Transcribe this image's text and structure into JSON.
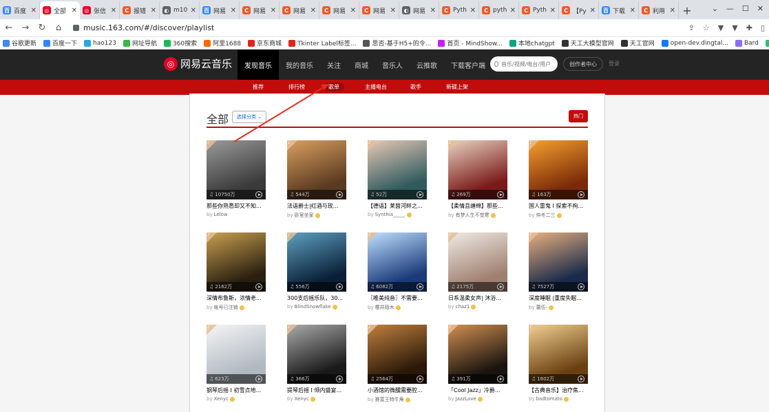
{
  "browser": {
    "tabs": [
      {
        "title": "百度",
        "color": "#3385ff",
        "glyph": "百"
      },
      {
        "title": "全部",
        "color": "#e60026",
        "glyph": "◎",
        "active": true
      },
      {
        "title": "张信",
        "color": "#e60026",
        "glyph": "◎"
      },
      {
        "title": "报错",
        "color": "#f05a28",
        "glyph": "C"
      },
      {
        "title": "m10",
        "color": "#5f6368",
        "glyph": "◐"
      },
      {
        "title": "网易",
        "color": "#3385ff",
        "glyph": "百"
      },
      {
        "title": "网易",
        "color": "#f05a28",
        "glyph": "C"
      },
      {
        "title": "网易",
        "color": "#f05a28",
        "glyph": "C"
      },
      {
        "title": "网易",
        "color": "#f05a28",
        "glyph": "C"
      },
      {
        "title": "网易",
        "color": "#f05a28",
        "glyph": "C"
      },
      {
        "title": "网易",
        "color": "#5f6368",
        "glyph": "◐"
      },
      {
        "title": "Pyth",
        "color": "#f05a28",
        "glyph": "C"
      },
      {
        "title": "pyth",
        "color": "#f05a28",
        "glyph": "C"
      },
      {
        "title": "Pyth",
        "color": "#f05a28",
        "glyph": "C"
      },
      {
        "title": "【Py",
        "color": "#f05a28",
        "glyph": "C"
      },
      {
        "title": "下载",
        "color": "#3385ff",
        "glyph": "百"
      },
      {
        "title": "利用",
        "color": "#f05a28",
        "glyph": "C"
      }
    ],
    "url": "music.163.com/#/discover/playlist",
    "bookmarks": [
      {
        "label": "谷歌更新",
        "color": "#4285f4"
      },
      {
        "label": "百度一下",
        "color": "#3385ff"
      },
      {
        "label": "hao123",
        "color": "#2ea7e0"
      },
      {
        "label": "网址导航",
        "color": "#3bb54a"
      },
      {
        "label": "360搜索",
        "color": "#19b955"
      },
      {
        "label": "阿里1688",
        "color": "#ff6a00"
      },
      {
        "label": "京东商城",
        "color": "#e1251b"
      },
      {
        "label": "Tkinter Label标签...",
        "color": "#e1251b"
      },
      {
        "label": "思否-基于H5+的令...",
        "color": "#555555"
      },
      {
        "label": "首页 - MindShow...",
        "color": "#c41dff"
      },
      {
        "label": "本地chatgpt",
        "color": "#10a37f"
      },
      {
        "label": "天工大模型官网",
        "color": "#333333"
      },
      {
        "label": "天工官网",
        "color": "#333333"
      },
      {
        "label": "open-dev.dingtal...",
        "color": "#1677ff"
      },
      {
        "label": "Bard",
        "color": "#8e6cff"
      },
      {
        "label": "Dashboard - Run...",
        "color": "#2fbf71"
      }
    ]
  },
  "site": {
    "logo_text": "网易云音乐",
    "nav": [
      "发现音乐",
      "我的音乐",
      "关注",
      "商城",
      "音乐人",
      "云推歌",
      "下载客户端"
    ],
    "search_placeholder": "音乐/视频/电台/用户",
    "creator_label": "创作者中心",
    "login_label": "登录",
    "subnav": [
      "推荐",
      "排行榜",
      "歌单",
      "主播电台",
      "歌手",
      "新碟上架"
    ]
  },
  "playlist_page": {
    "title": "全部",
    "category_button": "选择分类 ⌄",
    "hot_button": "热门",
    "cards": [
      {
        "name": "那些你熟悉却又不知...",
        "by": "Lelow",
        "plays": "10750万",
        "c1": "#3a3a3a",
        "c2": "#9a9a9a",
        "vip": false
      },
      {
        "name": "法语爵士|红酒与玫...",
        "by": "卧室坐家",
        "plays": "544万",
        "c1": "#5a3a20",
        "c2": "#d9a060",
        "vip": true
      },
      {
        "name": "【德语】莱茵河畔之...",
        "by": "Synthia_____",
        "plays": "52万",
        "c1": "#2f5a5e",
        "c2": "#e7c9b5",
        "vip": true
      },
      {
        "name": "【柔情且缠绵】那些...",
        "by": "有梦人生不觉寒",
        "plays": "269万",
        "c1": "#7a1a1a",
        "c2": "#e8d3c0",
        "vip": true
      },
      {
        "name": "国人雷鬼 I 探索不拘...",
        "by": "仲冬二三",
        "plays": "163万",
        "c1": "#7a2a08",
        "c2": "#f5a030",
        "vip": true
      },
      {
        "name": "深情布鲁斯，浓情老...",
        "by": "帐号已注销",
        "plays": "2162万",
        "c1": "#2a2010",
        "c2": "#c8a050",
        "vip": true
      },
      {
        "name": "300支后摇乐队，30...",
        "by": "BlindSnowflake",
        "plays": "556万",
        "c1": "#0a2038",
        "c2": "#5fa0c0",
        "vip": true
      },
      {
        "name": "〖唯美纯音〗不需要...",
        "by": "樱井陌木",
        "plays": "6082万",
        "c1": "#1a3a7a",
        "c2": "#bfe0ff",
        "vip": true
      },
      {
        "name": "日系温柔女声| 沐浴...",
        "by": "chaz1",
        "plays": "2175万",
        "c1": "#a08070",
        "c2": "#f0ebe6",
        "vip": true
      },
      {
        "name": "深度睡眠 |重度失眠...",
        "by": "蕾伍-",
        "plays": "7527万",
        "c1": "#1a2a4a",
        "c2": "#e8b080",
        "vip": true
      },
      {
        "name": "钢琴后摇 I 初雪点地...",
        "by": "Xenyc",
        "plays": "623万",
        "c1": "#b0b8c0",
        "c2": "#f5f5f5",
        "vip": true
      },
      {
        "name": "提琴后摇 I 倾内盛宴...",
        "by": "Xenyc",
        "plays": "366万",
        "c1": "#1a1a1a",
        "c2": "#aaaaaa",
        "vip": true
      },
      {
        "name": "小酒馆的微醺需要腔...",
        "by": "赛富王特牛角",
        "plays": "2564万",
        "c1": "#2a1808",
        "c2": "#c08040",
        "vip": true
      },
      {
        "name": "「Cool Jazz」冷爵...",
        "by": "JazzLove",
        "plays": "391万",
        "c1": "#1a1410",
        "c2": "#d09050",
        "vip": true
      },
      {
        "name": "【古典音乐】治疗焦...",
        "by": "badtomato",
        "plays": "1602万",
        "c1": "#6a4010",
        "c2": "#f0d090",
        "vip": true
      }
    ]
  },
  "annotation": {
    "color": "#e03020"
  }
}
